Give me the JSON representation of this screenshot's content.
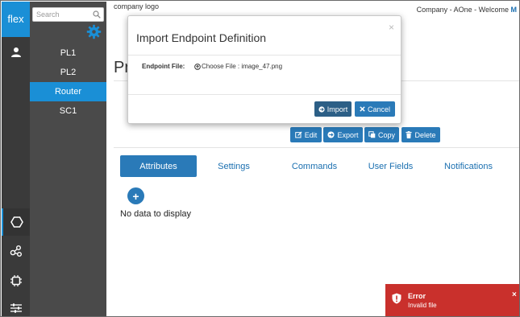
{
  "brand": {
    "label": "flex",
    "color": "#1a8fd6"
  },
  "rail_icons": [
    "user-icon",
    "hexagon-icon",
    "nodes-icon",
    "chip-icon",
    "sliders-icon"
  ],
  "sidebar": {
    "search_placeholder": "Search",
    "items": [
      {
        "label": "PL1",
        "selected": false
      },
      {
        "label": "PL2",
        "selected": false
      },
      {
        "label": "Router",
        "selected": true
      },
      {
        "label": "SC1",
        "selected": false
      }
    ]
  },
  "header": {
    "logo_text": "company logo",
    "welcome_text": "Company - AOne - Welcome",
    "user_initial": "M"
  },
  "page": {
    "title": "Pr"
  },
  "actions": {
    "edit": "Edit",
    "export": "Export",
    "copy": "Copy",
    "delete": "Delete"
  },
  "tabs": [
    "Attributes",
    "Settings",
    "Commands",
    "User Fields",
    "Notifications"
  ],
  "content": {
    "empty_text": "No data to display"
  },
  "modal": {
    "title": "Import Endpoint Definition",
    "close": "×",
    "field_label": "Endpoint File:",
    "choose_file_text": "Choose File : image_47.png",
    "import_label": "Import",
    "cancel_label": "Cancel"
  },
  "toast": {
    "title": "Error",
    "message": "Invalid file",
    "close": "×",
    "color": "#c9302c"
  }
}
